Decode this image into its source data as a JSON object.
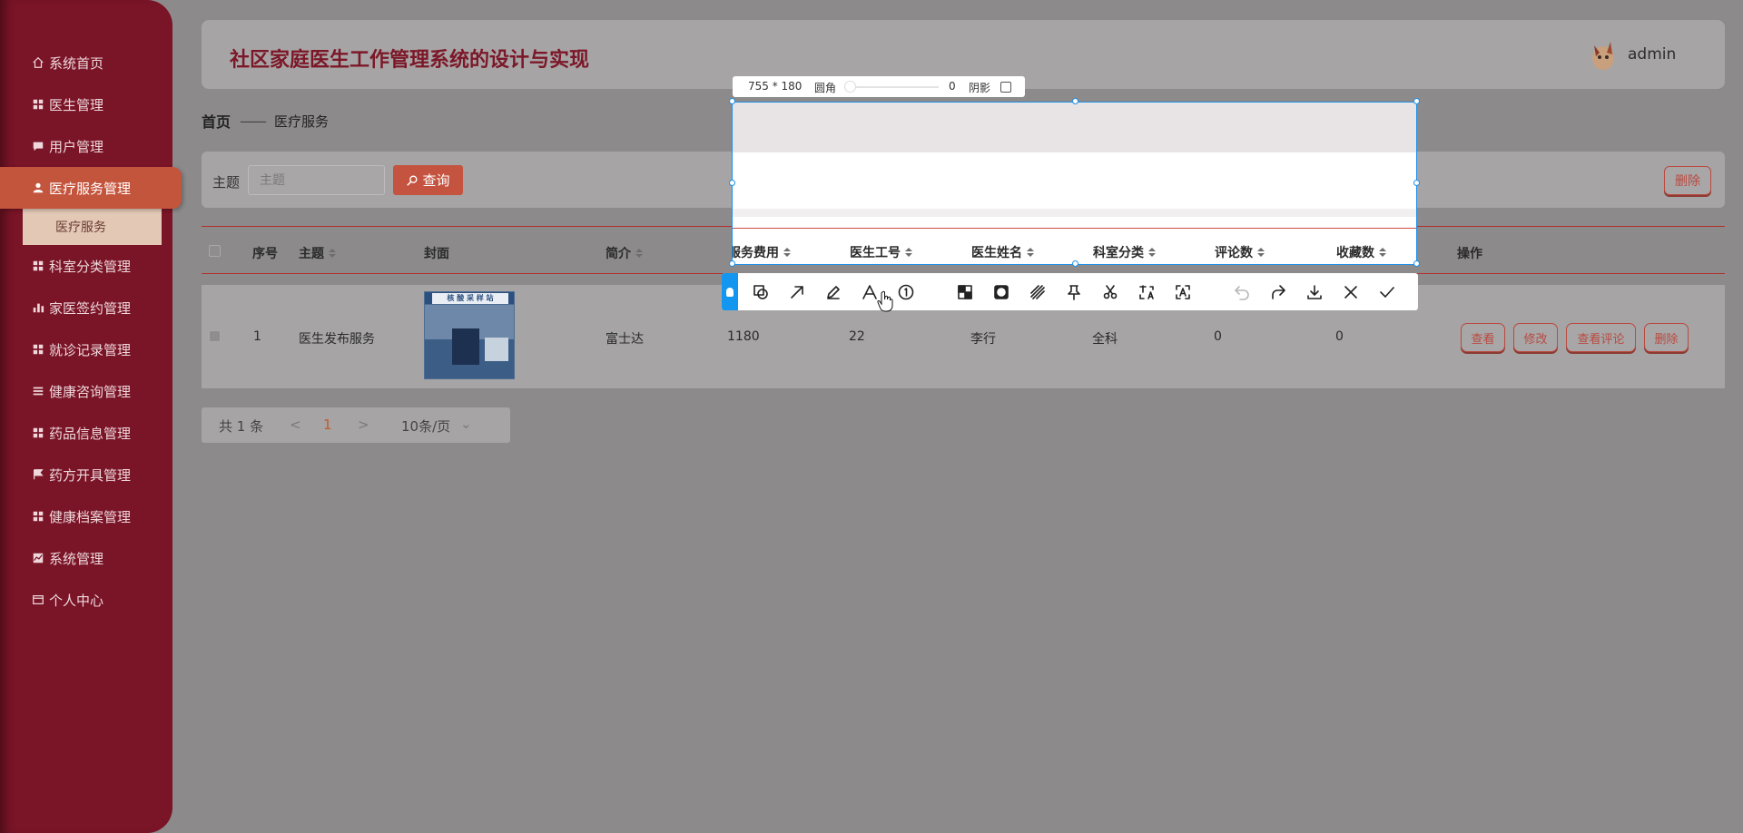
{
  "sidebar": {
    "items": [
      {
        "label": "系统首页",
        "icon": "home-icon"
      },
      {
        "label": "医生管理",
        "icon": "grid-icon"
      },
      {
        "label": "用户管理",
        "icon": "chat-icon"
      },
      {
        "label": "医疗服务管理",
        "icon": "user-icon"
      },
      {
        "label": "科室分类管理",
        "icon": "grid-icon"
      },
      {
        "label": "家医签约管理",
        "icon": "bar-chart-icon"
      },
      {
        "label": "就诊记录管理",
        "icon": "grid-icon"
      },
      {
        "label": "健康咨询管理",
        "icon": "list-icon"
      },
      {
        "label": "药品信息管理",
        "icon": "grid-icon"
      },
      {
        "label": "药方开具管理",
        "icon": "flag-icon"
      },
      {
        "label": "健康档案管理",
        "icon": "grid-icon"
      },
      {
        "label": "系统管理",
        "icon": "trend-icon"
      },
      {
        "label": "个人中心",
        "icon": "card-icon"
      }
    ],
    "sub_item": "医疗服务"
  },
  "header": {
    "title": "社区家庭医生工作管理系统的设计与实现",
    "user": "admin"
  },
  "breadcrumb": {
    "home": "首页",
    "separator": "——",
    "current": "医疗服务"
  },
  "search": {
    "label": "主题",
    "placeholder": "主题",
    "query_button": "查询",
    "delete_button": "删除"
  },
  "table": {
    "columns": [
      "序号",
      "主题",
      "封面",
      "简介",
      "服务费用",
      "医生工号",
      "医生姓名",
      "科室分类",
      "评论数",
      "收藏数",
      "操作"
    ],
    "rows": [
      {
        "index": "1",
        "subject": "医生发布服务",
        "cover_text": "核 酸 采 样 站",
        "intro": "富士达",
        "fee": "1180",
        "doctor_id": "22",
        "doctor_name": "李行",
        "department": "全科",
        "comments": "0",
        "favorites": "0",
        "actions": [
          "查看",
          "修改",
          "查看评论",
          "删除"
        ]
      }
    ]
  },
  "pagination": {
    "total": "共 1 条",
    "prev": "<",
    "page": "1",
    "next": ">",
    "page_size": "10条/页"
  },
  "screenshot_tool": {
    "size": "755 * 180",
    "radius_label": "圆角",
    "radius_value": "0",
    "shadow_label": "阴影",
    "selection_headers": [
      "服务费用",
      "医生工号",
      "医生姓名",
      "科室分类",
      "评论数",
      "收藏数"
    ],
    "tools": [
      "shape-icon",
      "arrow-icon",
      "pencil-icon",
      "text-icon",
      "number-icon",
      "mosaic-icon",
      "blur-icon",
      "stripe-icon",
      "pin-icon",
      "scissors-icon",
      "translate-icon",
      "ocr-icon",
      "undo-icon",
      "redo-icon",
      "download-icon",
      "cancel-icon",
      "confirm-icon"
    ]
  },
  "colors": {
    "sidebar": "#7a1427",
    "accent": "#c4533f",
    "title": "#7c1728",
    "selection": "#1e90e8"
  }
}
